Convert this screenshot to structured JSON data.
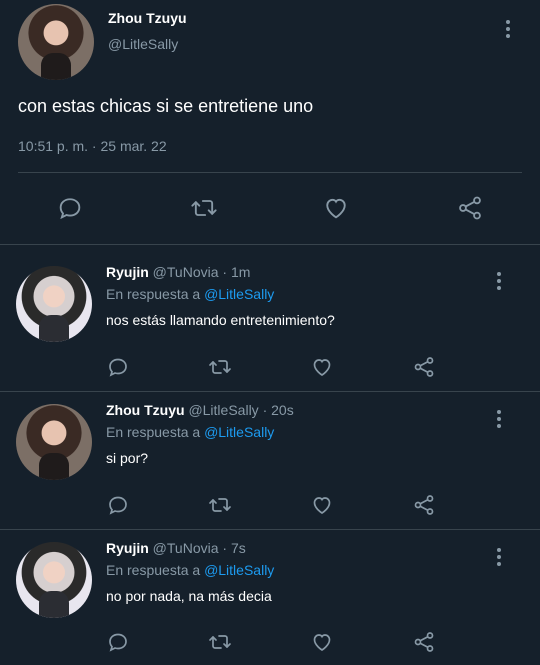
{
  "main_tweet": {
    "author_name": "Zhou Tzuyu",
    "author_handle": "@LitleSally",
    "text": "con estas chicas si se entretiene uno",
    "timestamp": "10:51 p. m. · 25 mar. 22"
  },
  "replies": [
    {
      "name": "Ryujin",
      "handle": "@TuNovia",
      "time": "1m",
      "in_reply_prefix": "En respuesta a ",
      "in_reply_to": "@LitleSally",
      "text": "nos estás llamando entretenimiento?"
    },
    {
      "name": "Zhou Tzuyu",
      "handle": "@LitleSally",
      "time": "20s",
      "in_reply_prefix": "En respuesta a ",
      "in_reply_to": "@LitleSally",
      "text": "si por?"
    },
    {
      "name": "Ryujin",
      "handle": "@TuNovia",
      "time": "7s",
      "in_reply_prefix": "En respuesta a ",
      "in_reply_to": "@LitleSally",
      "text": "no por nada, na más decia"
    }
  ],
  "meta_separator": " · ",
  "icons": {
    "reply": "comment-icon",
    "retweet": "retweet-icon",
    "like": "heart-icon",
    "share": "share-icon",
    "more": "more-vertical-icon"
  },
  "colors": {
    "background": "#15202b",
    "text_primary": "#ffffff",
    "text_secondary": "#8899a6",
    "accent": "#1d9bf0",
    "border": "#38444d"
  }
}
